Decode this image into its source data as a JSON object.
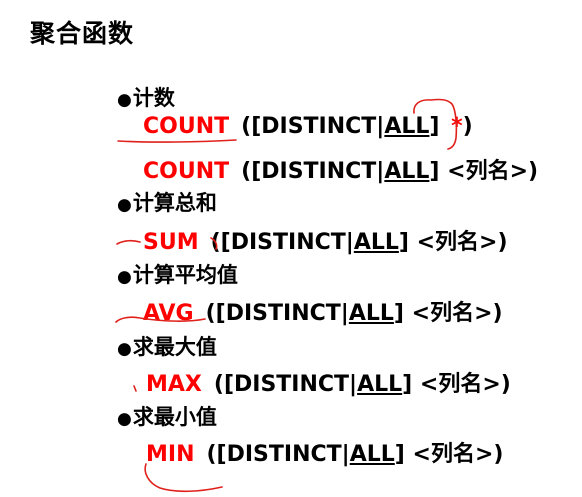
{
  "title": "聚合函数",
  "colors": {
    "function_name": "#ff0000",
    "text": "#000000",
    "annotation_ink": "#e0201a"
  },
  "bullet_glyph": "●",
  "sections": [
    {
      "heading": "计数",
      "lines": [
        {
          "fn": "COUNT",
          "open": "([DISTINCT|",
          "all": "ALL",
          "close_bracket": "]",
          "arg": "*",
          "close": ")"
        },
        {
          "fn": "COUNT",
          "open": "([DISTINCT|",
          "all": "ALL",
          "close_bracket": "]",
          "arg": "<列名>",
          "close": ")"
        }
      ]
    },
    {
      "heading": "计算总和",
      "lines": [
        {
          "fn": "SUM",
          "open": "([DISTINCT|",
          "all": "ALL",
          "close_bracket": "]",
          "arg": "<列名>",
          "close": ")"
        }
      ]
    },
    {
      "heading": "计算平均值",
      "lines": [
        {
          "fn": "AVG",
          "open": "([DISTINCT|",
          "all": "ALL",
          "close_bracket": "]",
          "arg": "<列名>",
          "close": ")"
        }
      ]
    },
    {
      "heading": "求最大值",
      "lines": [
        {
          "fn": "MAX",
          "open": "([DISTINCT|",
          "all": "ALL",
          "close_bracket": "]",
          "arg": "<列名>",
          "close": ")"
        }
      ]
    },
    {
      "heading": "求最小值",
      "lines": [
        {
          "fn": "MIN",
          "open": "([DISTINCT|",
          "all": "ALL",
          "close_bracket": "]",
          "arg": "<列名>",
          "close": ")"
        }
      ]
    }
  ]
}
